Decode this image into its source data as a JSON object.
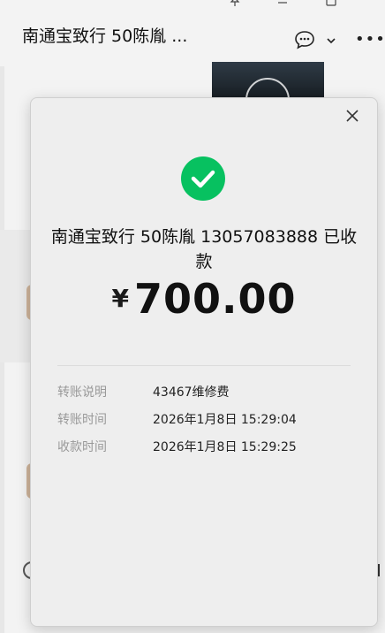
{
  "window": {
    "pin_icon": "pin-icon",
    "minimize_icon": "minimize-icon",
    "maximize_icon": "maximize-icon"
  },
  "chat": {
    "title": "南通宝致行 50陈胤 ...",
    "chat_icon": "chat-bubble-icon",
    "chevron_icon": "chevron-down-icon",
    "more_label": "•••"
  },
  "modal": {
    "close_icon": "close-icon",
    "status_icon": "check-circle-icon",
    "title": "南通宝致行 50陈胤 13057083888 已收款",
    "currency": "¥",
    "amount": "700.00",
    "details": [
      {
        "label": "转账说明",
        "value": "43467维修费"
      },
      {
        "label": "转账时间",
        "value": "2026年1月8日 15:29:04"
      },
      {
        "label": "收款时间",
        "value": "2026年1月8日 15:29:25"
      }
    ]
  },
  "colors": {
    "success_green": "#07c160",
    "modal_bg": "#eeeeee",
    "label_gray": "#999999"
  }
}
